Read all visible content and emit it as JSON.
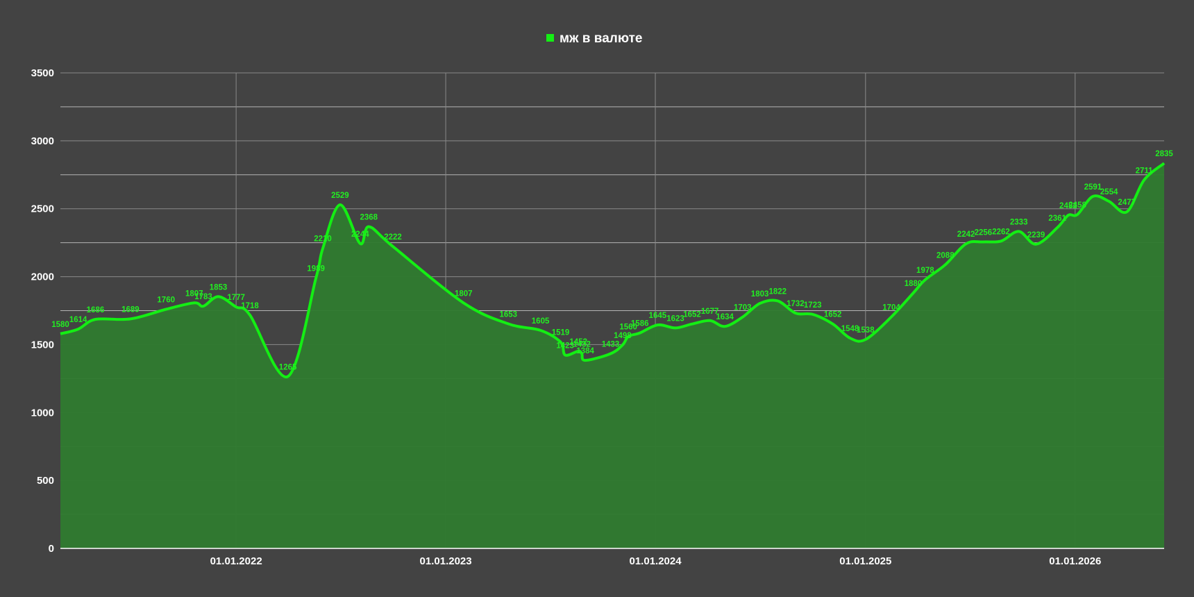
{
  "chart_data": {
    "type": "area",
    "series": [
      {
        "name": "мж в валюте",
        "color": "#14ee14",
        "fill": "#2f7a2f",
        "points": [
          [
            "2021-03-01",
            1580
          ],
          [
            "2021-04-01",
            1614
          ],
          [
            "2021-05-01",
            1686
          ],
          [
            "2021-07-01",
            1689
          ],
          [
            "2021-09-01",
            1760
          ],
          [
            "2021-10-20",
            1807
          ],
          [
            "2021-11-05",
            1783
          ],
          [
            "2021-12-01",
            1853
          ],
          [
            "2022-01-01",
            1777
          ],
          [
            "2022-01-25",
            1718
          ],
          [
            "2022-04-01",
            1265
          ],
          [
            "2022-05-20",
            1989
          ],
          [
            "2022-06-01",
            2210
          ],
          [
            "2022-07-01",
            2529
          ],
          [
            "2022-08-05",
            2244
          ],
          [
            "2022-08-20",
            2368
          ],
          [
            "2022-10-01",
            2222
          ],
          [
            "2023-02-01",
            1807
          ],
          [
            "2023-04-20",
            1653
          ],
          [
            "2023-06-15",
            1605
          ],
          [
            "2023-07-20",
            1519
          ],
          [
            "2023-07-28",
            1423
          ],
          [
            "2023-08-20",
            1452
          ],
          [
            "2023-08-26",
            1432
          ],
          [
            "2023-09-01",
            1384
          ],
          [
            "2023-10-15",
            1433
          ],
          [
            "2023-11-05",
            1498
          ],
          [
            "2023-11-15",
            1560
          ],
          [
            "2023-12-05",
            1586
          ],
          [
            "2024-01-05",
            1645
          ],
          [
            "2024-02-05",
            1623
          ],
          [
            "2024-03-05",
            1652
          ],
          [
            "2024-04-05",
            1677
          ],
          [
            "2024-05-01",
            1634
          ],
          [
            "2024-06-01",
            1703
          ],
          [
            "2024-07-01",
            1803
          ],
          [
            "2024-08-01",
            1822
          ],
          [
            "2024-09-01",
            1732
          ],
          [
            "2024-10-01",
            1723
          ],
          [
            "2024-11-05",
            1652
          ],
          [
            "2024-12-05",
            1548
          ],
          [
            "2025-01-01",
            1538
          ],
          [
            "2025-02-15",
            1704
          ],
          [
            "2025-03-25",
            1880
          ],
          [
            "2025-04-15",
            1978
          ],
          [
            "2025-05-20",
            2088
          ],
          [
            "2025-06-25",
            2242
          ],
          [
            "2025-07-25",
            2256
          ],
          [
            "2025-08-25",
            2262
          ],
          [
            "2025-09-25",
            2333
          ],
          [
            "2025-10-25",
            2239
          ],
          [
            "2025-12-01",
            2361
          ],
          [
            "2025-12-20",
            2452
          ],
          [
            "2026-01-05",
            2458
          ],
          [
            "2026-02-01",
            2591
          ],
          [
            "2026-03-01",
            2554
          ],
          [
            "2026-04-01",
            2477
          ],
          [
            "2026-05-01",
            2711
          ],
          [
            "2026-06-05",
            2835
          ]
        ]
      }
    ],
    "x_range": [
      "2021-03-01",
      "2026-06-05"
    ],
    "ylim": [
      0,
      3500
    ],
    "yticks": [
      0,
      500,
      1000,
      1500,
      2000,
      2500,
      3000,
      3500
    ],
    "xticks": [
      {
        "date": "2022-01-01",
        "label": "01.01.2022"
      },
      {
        "date": "2023-01-01",
        "label": "01.01.2023"
      },
      {
        "date": "2024-01-01",
        "label": "01.01.2024"
      },
      {
        "date": "2025-01-01",
        "label": "01.01.2025"
      },
      {
        "date": "2026-01-01",
        "label": "01.01.2026"
      }
    ],
    "legend_position": "top-center",
    "grid": true,
    "background": "#434343",
    "grid_color": "#8a8a8a"
  }
}
